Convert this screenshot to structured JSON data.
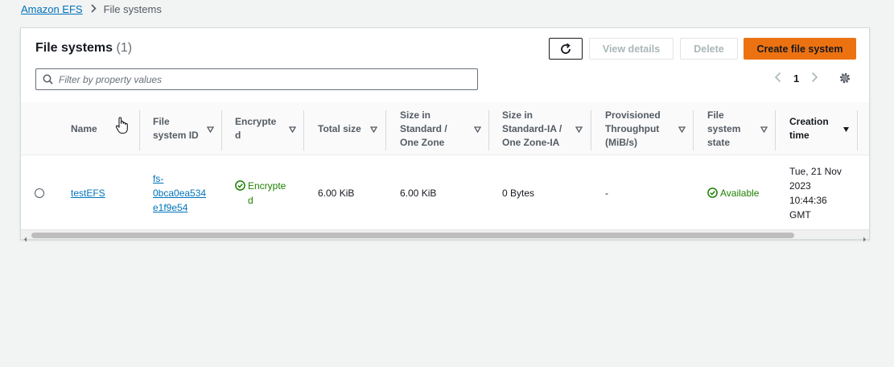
{
  "breadcrumb": {
    "parent": "Amazon EFS",
    "current": "File systems"
  },
  "panel": {
    "title": "File systems",
    "count": "(1)"
  },
  "buttons": {
    "view_details": "View details",
    "delete": "Delete",
    "create": "Create file system"
  },
  "filter": {
    "placeholder": "Filter by property values",
    "value": ""
  },
  "pagination": {
    "page": "1"
  },
  "columns": {
    "name": "Name",
    "fsid": [
      "File",
      "system ID"
    ],
    "encrypted": [
      "Encrypte",
      "d"
    ],
    "total_size": "Total size",
    "size_standard": [
      "Size in",
      "Standard /",
      "One Zone"
    ],
    "size_ia": [
      "Size in",
      "Standard-IA /",
      "One Zone-IA"
    ],
    "throughput": [
      "Provisioned",
      "Throughput",
      "(MiB/s)"
    ],
    "state": [
      "File",
      "system",
      "state"
    ],
    "creation_time": [
      "Creation",
      "time"
    ]
  },
  "rows": [
    {
      "name": "testEFS",
      "fsid": [
        "fs-",
        "0bca0ea534",
        "e1f9e54"
      ],
      "encrypted": [
        "Encrypte",
        "d"
      ],
      "total_size": "6.00 KiB",
      "size_standard": "6.00 KiB",
      "size_ia": "0 Bytes",
      "throughput": "-",
      "state": "Available",
      "creation_time": [
        "Tue, 21 Nov",
        "2023",
        "10:44:36",
        "GMT"
      ]
    }
  ],
  "colors": {
    "accent": "#ec7211",
    "link": "#0073bb",
    "success": "#1d8102"
  },
  "icons": [
    "chevron-right-icon",
    "refresh-icon",
    "search-icon",
    "chevron-left-icon",
    "settings-icon",
    "sort-icon",
    "sort-desc-icon",
    "check-circle-icon",
    "hand-cursor-icon"
  ]
}
